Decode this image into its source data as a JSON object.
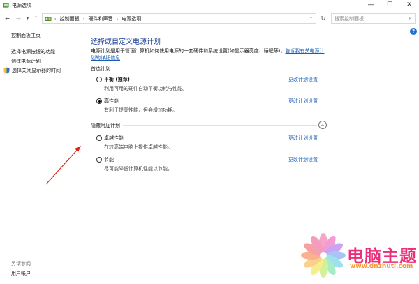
{
  "window": {
    "title": "电源选项",
    "minimize_glyph": "—",
    "maximize_glyph": "☐",
    "close_glyph": "✕"
  },
  "address": {
    "crumbs": [
      "控制面板",
      "硬件和声音",
      "电源选项"
    ],
    "search_placeholder": "搜索控制面板"
  },
  "sidebar": {
    "home": "控制面板主页",
    "links": [
      "选择电源按钮的功能",
      "创建电源计划",
      "选择关闭显示器的时间"
    ],
    "see_also": "另请参阅",
    "user_accounts": "用户帐户"
  },
  "main": {
    "title": "选择或自定义电源计划",
    "desc_prefix": "电源计划是用于管理计算机如何使用电源的一套硬件和系统设置(如显示器亮度、睡眠等)。",
    "desc_link": "告诉我有关电源计划的详细信息",
    "preferred_header": "首选计划",
    "hidden_header": "隐藏附加计划",
    "change_link": "更改计划设置",
    "plans": [
      {
        "name": "平衡 (推荐)",
        "desc": "利用可用的硬件自动平衡功耗与性能。",
        "selected": false,
        "bold": true
      },
      {
        "name": "高性能",
        "desc": "有利于提高性能，但会增加功耗。",
        "selected": true,
        "bold": false
      },
      {
        "name": "卓越性能",
        "desc": "在较高端电脑上提供卓越性能。",
        "selected": false,
        "bold": false
      },
      {
        "name": "节能",
        "desc": "尽可能降低计算机性能以节能。",
        "selected": false,
        "bold": false
      }
    ]
  },
  "watermark": {
    "title": "电脑主题",
    "url": "www.dnzhuti.com"
  },
  "colors": {
    "link": "#1a5fb4",
    "title_blue": "#1c3f94",
    "watermark_pink": "#ec2d7a",
    "watermark_orange": "#f39a3e",
    "arrow_red": "#d9261c"
  }
}
